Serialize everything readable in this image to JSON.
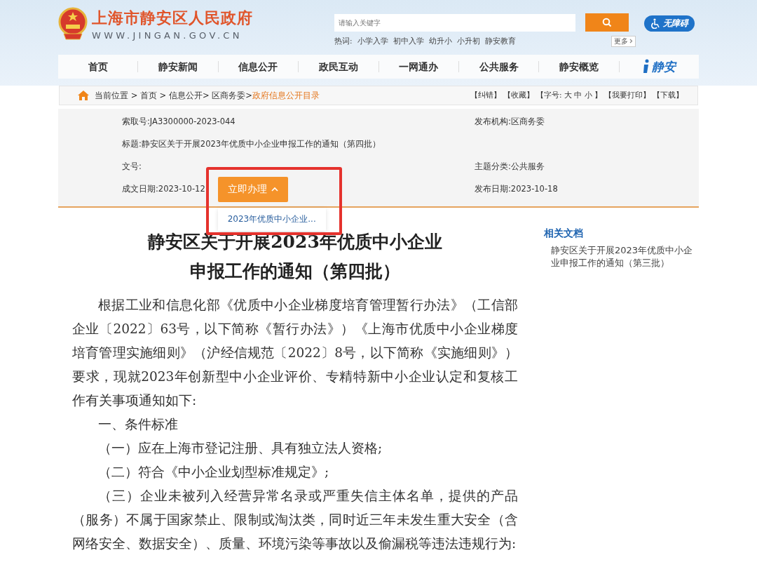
{
  "header": {
    "site_title": "上海市静安区人民政府",
    "site_url": "WWW.JINGAN.GOV.CN",
    "search": {
      "placeholder": "请输入关键字"
    },
    "hot_label": "热词:",
    "hot_words": [
      "小学入学",
      "初中入学",
      "幼升小",
      "小升初",
      "静安教育"
    ],
    "more": "更多",
    "accessibility": "无障碍"
  },
  "nav": {
    "items": [
      "首页",
      "静安新闻",
      "信息公开",
      "政民互动",
      "一网通办",
      "公共服务",
      "静安概览"
    ],
    "logo_text": "静安"
  },
  "breadcrumb": {
    "path": "当前位置 > 首页 > 信息公开> 区商务委>",
    "current": "政府信息公开目录",
    "tools": [
      "【纠错】",
      "【收藏】",
      "【字号: 大 中 小 】",
      "【我要打印】",
      "【下载】"
    ]
  },
  "info": {
    "index_no": "索取号:JA3300000-2023-044",
    "publisher": "发布机构:区商务委",
    "title": "标题:静安区关于开展2023年优质中小企业申报工作的通知（第四批）",
    "doc_no": "文号:",
    "category": "主题分类:公共服务",
    "written_date": "成文日期:2023-10-12",
    "publish_date": "发布日期:2023-10-18",
    "action_button": "立即办理",
    "dropdown": {
      "expanded": true,
      "items": [
        "2023年优质中小企业..."
      ]
    }
  },
  "article": {
    "title_lines": [
      "静安区关于开展2023年优质中小企业",
      "申报工作的通知（第四批）"
    ],
    "paragraphs": [
      "根据工业和信息化部《优质中小企业梯度培育管理暂行办法》（工信部企业〔2022〕63号，以下简称《暂行办法》）《上海市优质中小企业梯度培育管理实施细则》（沪经信规范〔2022〕8号，以下简称《实施细则》）要求，现就2023年创新型中小企业评价、专精特新中小企业认定和复核工作有关事项通知如下:",
      "一、条件标准",
      "（一）应在上海市登记注册、具有独立法人资格;",
      "（二）符合《中小企业划型标准规定》;",
      "（三）企业未被列入经营异常名录或严重失信主体名单，提供的产品（服务）不属于国家禁止、限制或淘汰类，同时近三年未发生重大安全（含网络安全、数据安全）、质量、环境污染等事故以及偷漏税等违法违规行为:"
    ]
  },
  "related": {
    "heading": "相关文档",
    "items": [
      "静安区关于开展2023年优质中小企业申报工作的通知（第三批）"
    ]
  }
}
